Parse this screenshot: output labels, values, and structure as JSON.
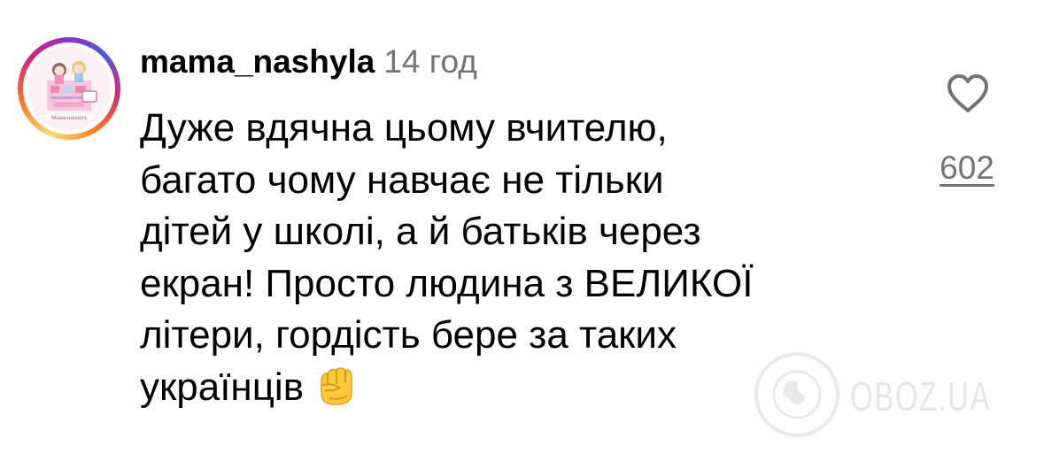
{
  "comment": {
    "username": "mama_nashyla",
    "time": "14 год",
    "text_lines": [
      "Дуже вдячна цьому вчителю,",
      "багато чому навчає не тільки",
      "дітей у школі, а й батьків через",
      "екран! Просто людина з ВЕЛИКОЇ",
      "літери, гордість бере за таких",
      "українців"
    ],
    "emoji": "raised-fist",
    "likes": "602"
  },
  "avatar": {
    "logo_text": "Мама-нашила"
  },
  "watermark": {
    "text": "OBOZ.UA"
  },
  "colors": {
    "text": "#000000",
    "secondary": "#737373",
    "fist": "#FFC83D"
  },
  "icons": {
    "like": "heart-outline-icon",
    "emoji": "raised-fist-emoji"
  }
}
